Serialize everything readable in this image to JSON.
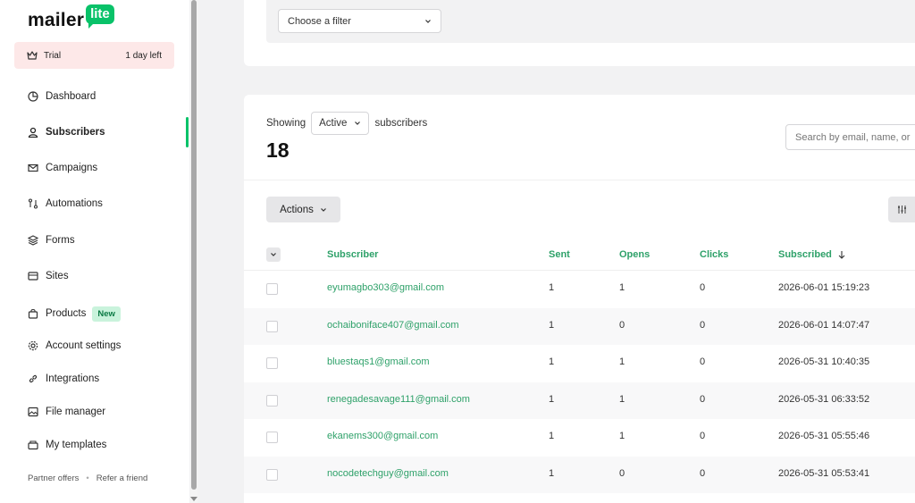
{
  "brand": {
    "name_part1": "mailer",
    "name_part2": "lite",
    "accent": "#09c269"
  },
  "trial": {
    "label": "Trial",
    "remaining": "1 day left"
  },
  "sidebar": {
    "items": [
      {
        "label": "Dashboard",
        "icon": "dashboard-icon"
      },
      {
        "label": "Subscribers",
        "icon": "user-icon",
        "active": true
      },
      {
        "label": "Campaigns",
        "icon": "mail-icon"
      },
      {
        "label": "Automations",
        "icon": "automation-icon"
      },
      {
        "label": "Forms",
        "icon": "layers-icon"
      },
      {
        "label": "Sites",
        "icon": "browser-icon"
      },
      {
        "label": "Products",
        "icon": "bag-icon",
        "badge": "New"
      },
      {
        "label": "Account settings",
        "icon": "gear-icon"
      },
      {
        "label": "Integrations",
        "icon": "link-icon"
      },
      {
        "label": "File manager",
        "icon": "image-icon"
      },
      {
        "label": "My templates",
        "icon": "folder-icon"
      }
    ],
    "footer": {
      "partner_offers": "Partner offers",
      "refer": "Refer a friend"
    }
  },
  "filter": {
    "placeholder": "Choose a filter"
  },
  "subscribers": {
    "showing_label": "Showing",
    "status_value": "Active",
    "suffix_label": "subscribers",
    "count": "18",
    "search_placeholder": "Search by email, name, or"
  },
  "toolbar": {
    "actions_label": "Actions"
  },
  "table": {
    "headers": {
      "subscriber": "Subscriber",
      "sent": "Sent",
      "opens": "Opens",
      "clicks": "Clicks",
      "subscribed": "Subscribed"
    },
    "rows": [
      {
        "email": "eyumagbo303@gmail.com",
        "sent": "1",
        "opens": "1",
        "clicks": "0",
        "subscribed": "2026-06-01 15:19:23"
      },
      {
        "email": "ochaiboniface407@gmail.com",
        "sent": "1",
        "opens": "0",
        "clicks": "0",
        "subscribed": "2026-06-01 14:07:47"
      },
      {
        "email": "bluestaqs1@gmail.com",
        "sent": "1",
        "opens": "1",
        "clicks": "0",
        "subscribed": "2026-05-31 10:40:35"
      },
      {
        "email": "renegadesavage111@gmail.com",
        "sent": "1",
        "opens": "1",
        "clicks": "0",
        "subscribed": "2026-05-31 06:33:52"
      },
      {
        "email": "ekanems300@gmail.com",
        "sent": "1",
        "opens": "1",
        "clicks": "0",
        "subscribed": "2026-05-31 05:55:46"
      },
      {
        "email": "nocodetechguy@gmail.com",
        "sent": "1",
        "opens": "0",
        "clicks": "0",
        "subscribed": "2026-05-31 05:53:41"
      }
    ]
  }
}
